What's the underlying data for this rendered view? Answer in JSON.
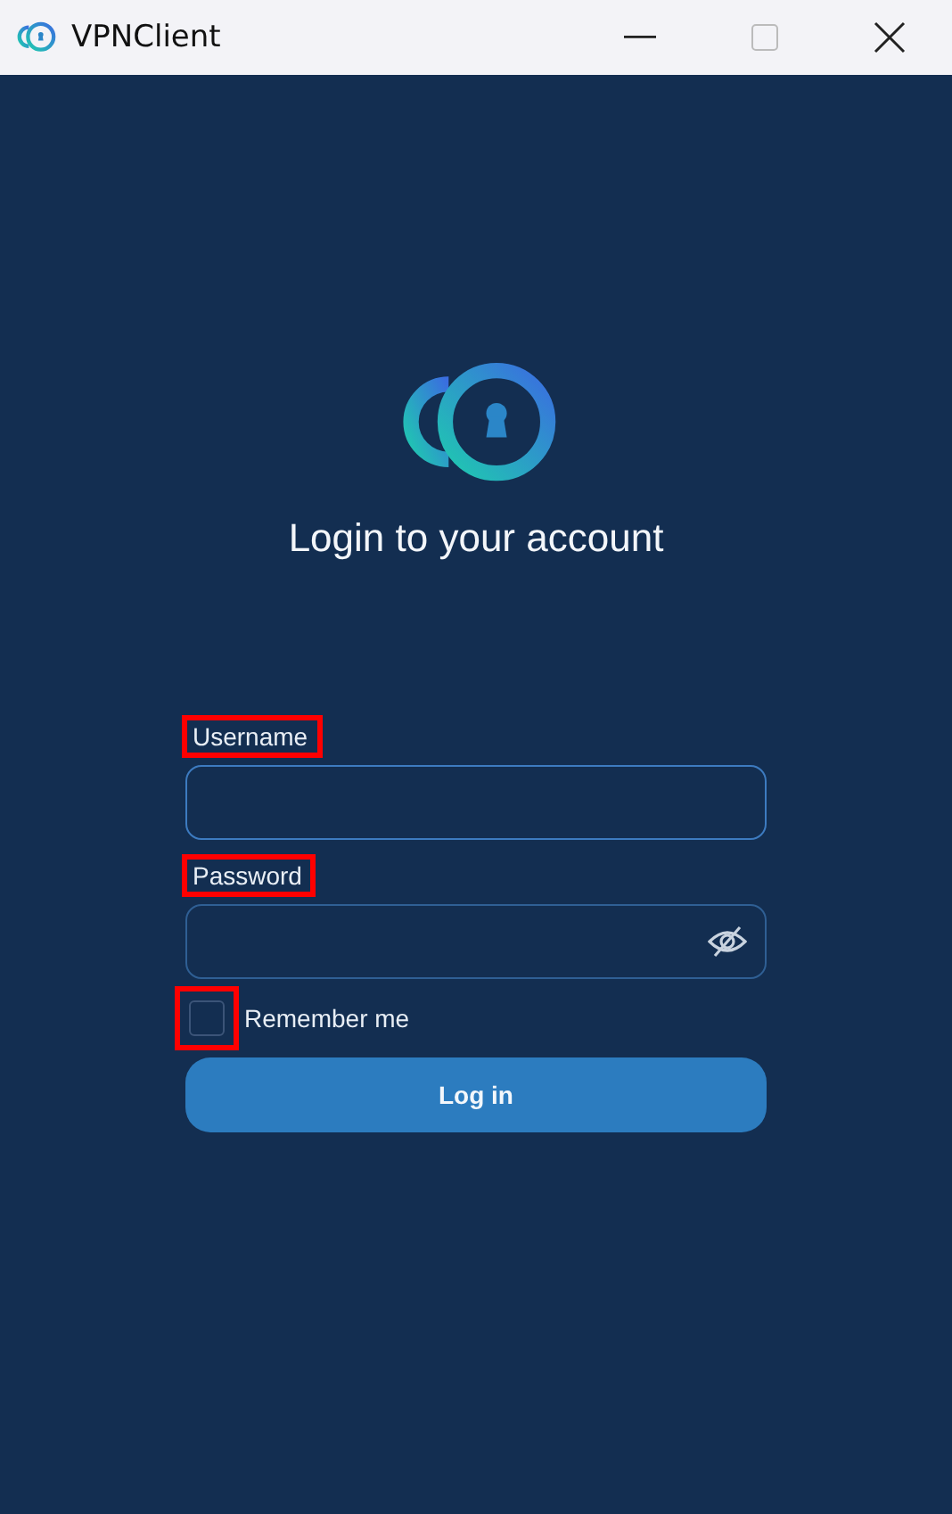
{
  "window": {
    "title": "VPNClient"
  },
  "heading": "Login to your account",
  "fields": [
    {
      "label": "Username",
      "kind": "text",
      "highlighted": true
    },
    {
      "label": "Password",
      "kind": "password",
      "highlighted": true
    }
  ],
  "remember": {
    "label": "Remember me",
    "checked": false,
    "highlighted": true
  },
  "login_button": "Log in"
}
